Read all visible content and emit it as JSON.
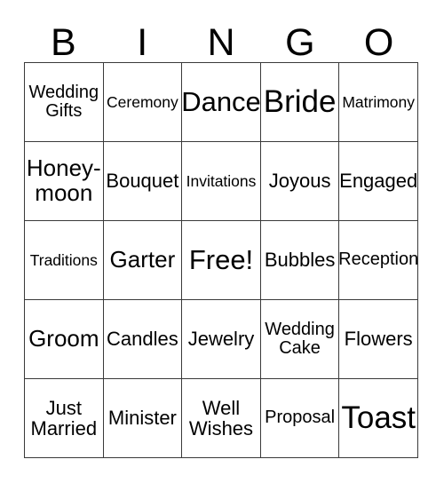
{
  "card": {
    "title": "BINGO",
    "header_letters": [
      "B",
      "I",
      "N",
      "G",
      "O"
    ],
    "border_color": "#3a3a3a",
    "background_color": "#ffffff",
    "text_color": "#000000",
    "columns": 5,
    "rows": 5,
    "free_space_label": "Free!",
    "cells": [
      {
        "text": "Wedding\nGifts",
        "size": "s"
      },
      {
        "text": "Ceremony",
        "size": "xs"
      },
      {
        "text": "Dance",
        "size": "xl"
      },
      {
        "text": "Bride",
        "size": "xxl"
      },
      {
        "text": "Matrimony",
        "size": "xs"
      },
      {
        "text": "Honey-\nmoon",
        "size": "l"
      },
      {
        "text": "Bouquet",
        "size": "m"
      },
      {
        "text": "Invitations",
        "size": "xs"
      },
      {
        "text": "Joyous",
        "size": "m"
      },
      {
        "text": "Engaged",
        "size": "m"
      },
      {
        "text": "Traditions",
        "size": "xs"
      },
      {
        "text": "Garter",
        "size": "l"
      },
      {
        "text": "Free!",
        "size": "xl"
      },
      {
        "text": "Bubbles",
        "size": "m"
      },
      {
        "text": "Reception",
        "size": "s"
      },
      {
        "text": "Groom",
        "size": "l"
      },
      {
        "text": "Candles",
        "size": "m"
      },
      {
        "text": "Jewelry",
        "size": "m"
      },
      {
        "text": "Wedding\nCake",
        "size": "s"
      },
      {
        "text": "Flowers",
        "size": "m"
      },
      {
        "text": "Just\nMarried",
        "size": "m"
      },
      {
        "text": "Minister",
        "size": "m"
      },
      {
        "text": "Well\nWishes",
        "size": "m"
      },
      {
        "text": "Proposal",
        "size": "s"
      },
      {
        "text": "Toast",
        "size": "xxl"
      }
    ]
  }
}
